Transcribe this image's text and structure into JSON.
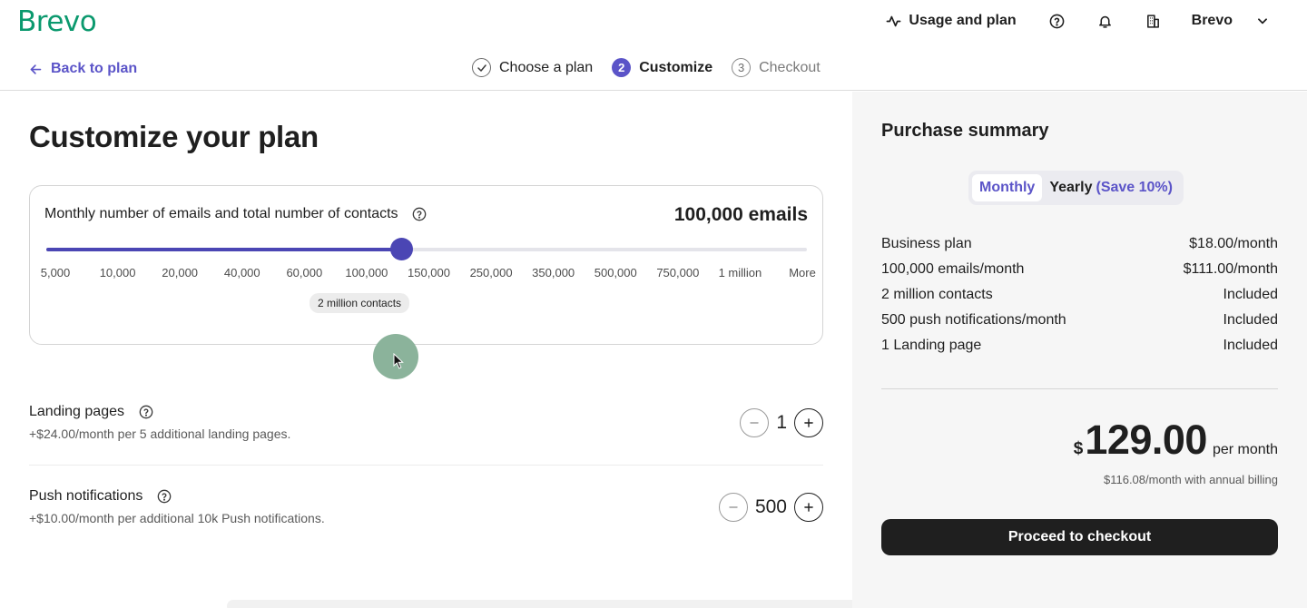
{
  "header": {
    "logo": "Brevo",
    "usage_label": "Usage and plan",
    "org_name": "Brevo",
    "back_label": "Back to plan"
  },
  "stepper": [
    {
      "number": "1",
      "label": "Choose a plan",
      "state": "done"
    },
    {
      "number": "2",
      "label": "Customize",
      "state": "active"
    },
    {
      "number": "3",
      "label": "Checkout",
      "state": "todo"
    }
  ],
  "main": {
    "title": "Customize your plan",
    "slider": {
      "label": "Monthly number of emails and total number of contacts",
      "value_label": "100,000 emails",
      "ticks": [
        "5,000",
        "10,000",
        "20,000",
        "40,000",
        "60,000",
        "100,000",
        "150,000",
        "250,000",
        "350,000",
        "500,000",
        "750,000",
        "1 million",
        "More"
      ],
      "selected_index": 5,
      "contacts_badge": "2 million contacts"
    },
    "landing_pages": {
      "title": "Landing pages",
      "subtitle": "+$24.00/month per 5 additional landing pages.",
      "value": "1"
    },
    "push_notifications": {
      "title": "Push notifications",
      "subtitle": "+$10.00/month per additional 10k Push notifications.",
      "value": "500"
    }
  },
  "summary": {
    "title": "Purchase summary",
    "toggle": {
      "monthly": "Monthly",
      "yearly": "Yearly",
      "save": "(Save 10%)",
      "selected": "monthly"
    },
    "lines": [
      {
        "label": "Business plan",
        "value": "$18.00/month"
      },
      {
        "label": "100,000 emails/month",
        "value": "$111.00/month"
      },
      {
        "label": "2 million contacts",
        "value": "Included"
      },
      {
        "label": "500 push notifications/month",
        "value": "Included"
      },
      {
        "label": "1 Landing page",
        "value": "Included"
      }
    ],
    "currency": "$",
    "total": "129.00",
    "per": "per month",
    "annual_note": "$116.08/month with annual billing",
    "checkout_label": "Proceed to checkout"
  },
  "colors": {
    "brand_green": "#0b996e",
    "accent": "#5b54c8",
    "slider": "#4b46b4",
    "button_dark": "#1f1f1f"
  },
  "icons": [
    "activity-icon",
    "help-icon",
    "bell-icon",
    "building-icon",
    "chevron-down-icon",
    "arrow-left-icon",
    "check-icon",
    "minus-icon",
    "plus-icon",
    "cursor-icon"
  ]
}
